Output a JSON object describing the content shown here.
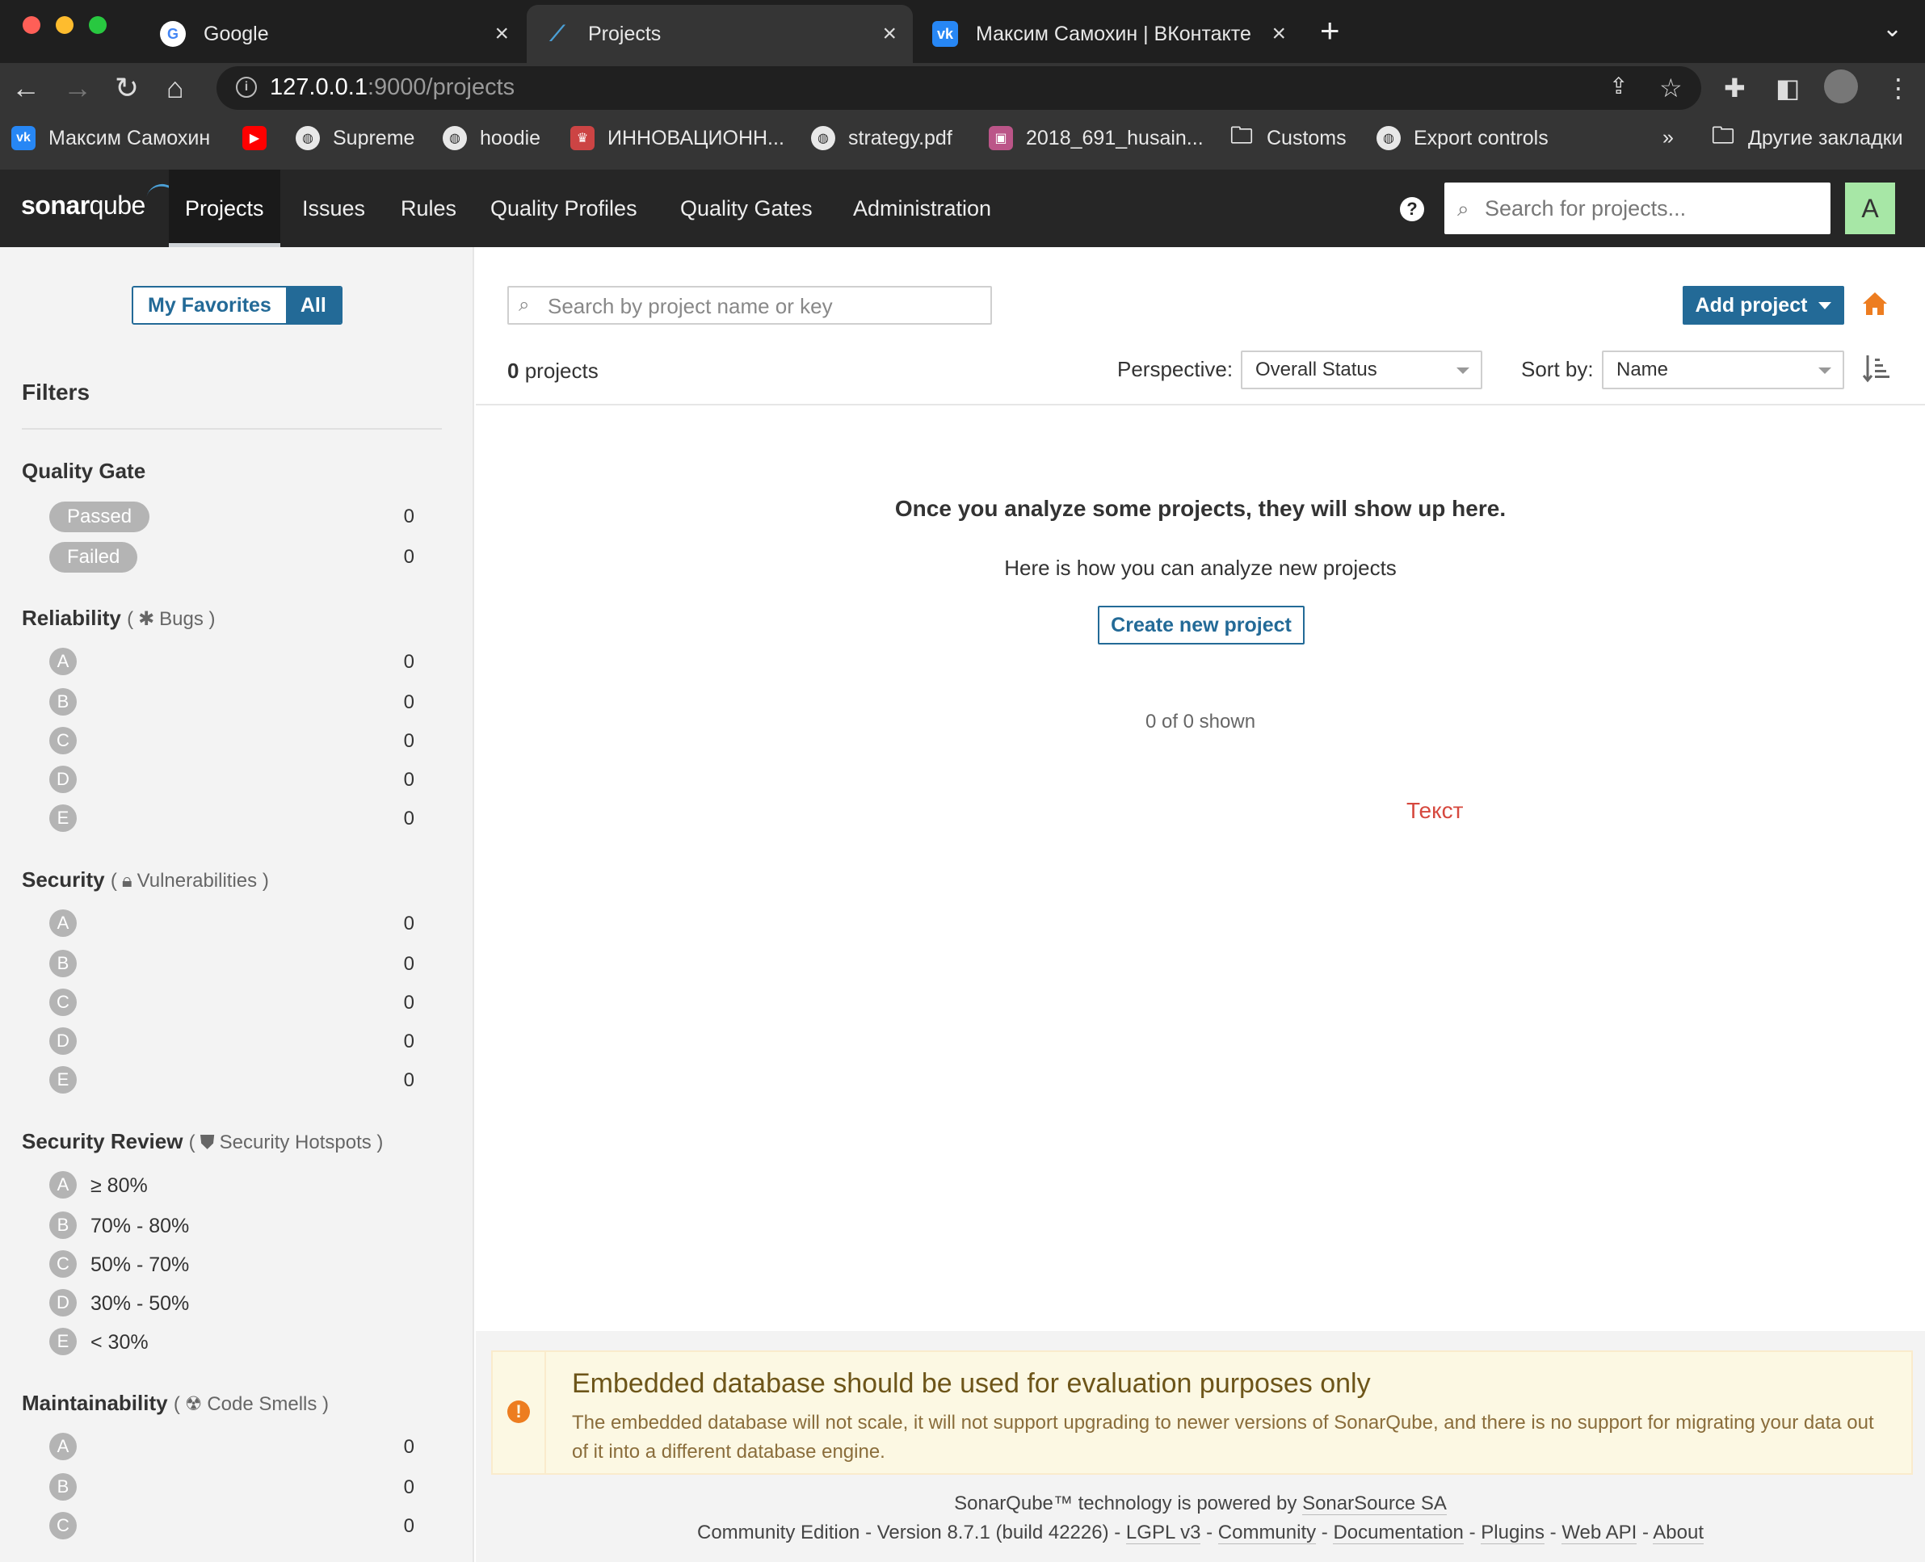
{
  "browser": {
    "tabs": [
      {
        "title": "Google",
        "icon": "google-icon"
      },
      {
        "title": "Projects",
        "icon": "sonarqube-icon"
      },
      {
        "title": "Максим Самохин | ВКонтакте",
        "icon": "vk-icon"
      }
    ],
    "url_host": "127.0.0.1",
    "url_rest": ":9000/projects",
    "bookmarks": [
      "Максим Самохин",
      "Supreme",
      "hoodie",
      "ИННОВАЦИОНН...",
      "strategy.pdf",
      "2018_691_husain...",
      "Customs",
      "Export controls"
    ],
    "bookmarks_overflow": "»",
    "other_bookmarks": "Другие закладки"
  },
  "nav": {
    "logo_bold": "sonar",
    "logo_light": "qube",
    "items": [
      "Projects",
      "Issues",
      "Rules",
      "Quality Profiles",
      "Quality Gates",
      "Administration"
    ],
    "help": "?",
    "search_placeholder": "Search for projects...",
    "avatar": "A"
  },
  "sidebar": {
    "my_favorites": "My Favorites",
    "all": "All",
    "filters_title": "Filters",
    "quality_gate": {
      "title": "Quality Gate",
      "options": [
        {
          "label": "Passed",
          "count": "0"
        },
        {
          "label": "Failed",
          "count": "0"
        }
      ]
    },
    "reliability": {
      "title": "Reliability",
      "sub": "Bugs",
      "grades": [
        {
          "g": "A",
          "count": "0"
        },
        {
          "g": "B",
          "count": "0"
        },
        {
          "g": "C",
          "count": "0"
        },
        {
          "g": "D",
          "count": "0"
        },
        {
          "g": "E",
          "count": "0"
        }
      ]
    },
    "security": {
      "title": "Security",
      "sub": "Vulnerabilities",
      "grades": [
        {
          "g": "A",
          "count": "0"
        },
        {
          "g": "B",
          "count": "0"
        },
        {
          "g": "C",
          "count": "0"
        },
        {
          "g": "D",
          "count": "0"
        },
        {
          "g": "E",
          "count": "0"
        }
      ]
    },
    "security_review": {
      "title": "Security Review",
      "sub": "Security Hotspots",
      "grades": [
        {
          "g": "A",
          "label": "≥ 80%"
        },
        {
          "g": "B",
          "label": "70% - 80%"
        },
        {
          "g": "C",
          "label": "50% - 70%"
        },
        {
          "g": "D",
          "label": "30% - 50%"
        },
        {
          "g": "E",
          "label": "< 30%"
        }
      ]
    },
    "maintainability": {
      "title": "Maintainability",
      "sub": "Code Smells",
      "grades": [
        {
          "g": "A",
          "count": "0"
        },
        {
          "g": "B",
          "count": "0"
        },
        {
          "g": "C",
          "count": "0"
        }
      ]
    }
  },
  "main": {
    "search_placeholder": "Search by project name or key",
    "add_project": "Add project",
    "count_num": "0",
    "count_label": "projects",
    "perspective_label": "Perspective:",
    "perspective_value": "Overall Status",
    "sort_label": "Sort by:",
    "sort_value": "Name",
    "empty_title": "Once you analyze some projects, they will show up here.",
    "empty_sub": "Here is how you can analyze new projects",
    "create_button": "Create new project",
    "shown": "0 of 0 shown",
    "red_text": "Текст"
  },
  "warning": {
    "title": "Embedded database should be used for evaluation purposes only",
    "body": "The embedded database will not scale, it will not support upgrading to newer versions of SonarQube, and there is no support for migrating your data out of it into a different database engine."
  },
  "footer": {
    "line1_text": "SonarQube™ technology is powered by",
    "line1_link": "SonarSource SA",
    "edition": "Community Edition - Version 8.7.1 (build 42226) -",
    "links": [
      "LGPL v3",
      "Community",
      "Documentation",
      "Plugins",
      "Web API",
      "About"
    ],
    "sep": "-"
  },
  "colors": {
    "accent": "#236a97",
    "nav_bg": "#262626",
    "warning_bg": "#fcf8e3",
    "home_orange": "#ed7d20",
    "red_text": "#d6483e"
  }
}
